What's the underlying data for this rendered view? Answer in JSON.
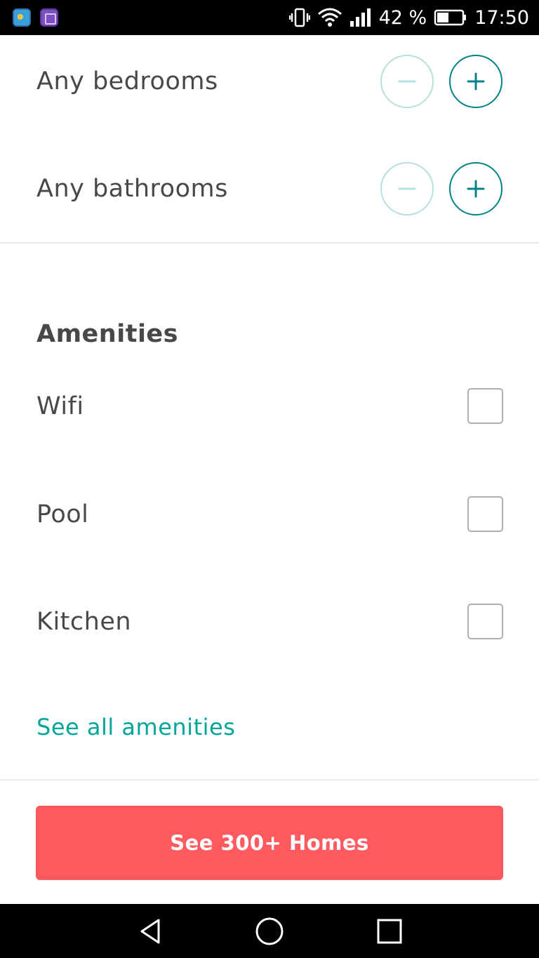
{
  "status_bar": {
    "battery_percent": "42 %",
    "time": "17:50",
    "notification_icons": [
      "weather-app-icon",
      "gallery-app-icon"
    ],
    "system_icons": [
      "vibrate-icon",
      "wifi-icon",
      "cellular-signal-icon",
      "battery-icon"
    ]
  },
  "filters": {
    "rooms": [
      {
        "label": "Any bedrooms",
        "minus_enabled": false,
        "plus_enabled": true
      },
      {
        "label": "Any bathrooms",
        "minus_enabled": false,
        "plus_enabled": true
      }
    ]
  },
  "amenities": {
    "title": "Amenities",
    "items": [
      {
        "label": "Wifi",
        "checked": false
      },
      {
        "label": "Pool",
        "checked": false
      },
      {
        "label": "Kitchen",
        "checked": false
      }
    ],
    "see_all_label": "See all amenities"
  },
  "cta": {
    "label": "See 300+ Homes"
  },
  "nav_bar": {
    "buttons": [
      "back-icon",
      "home-icon",
      "recents-icon"
    ]
  },
  "colors": {
    "accent_teal": "#008489",
    "accent_teal_light": "#b3e0e0",
    "link_teal": "#00a699",
    "cta_coral": "#ff5a5f",
    "text_dark": "#484848"
  }
}
